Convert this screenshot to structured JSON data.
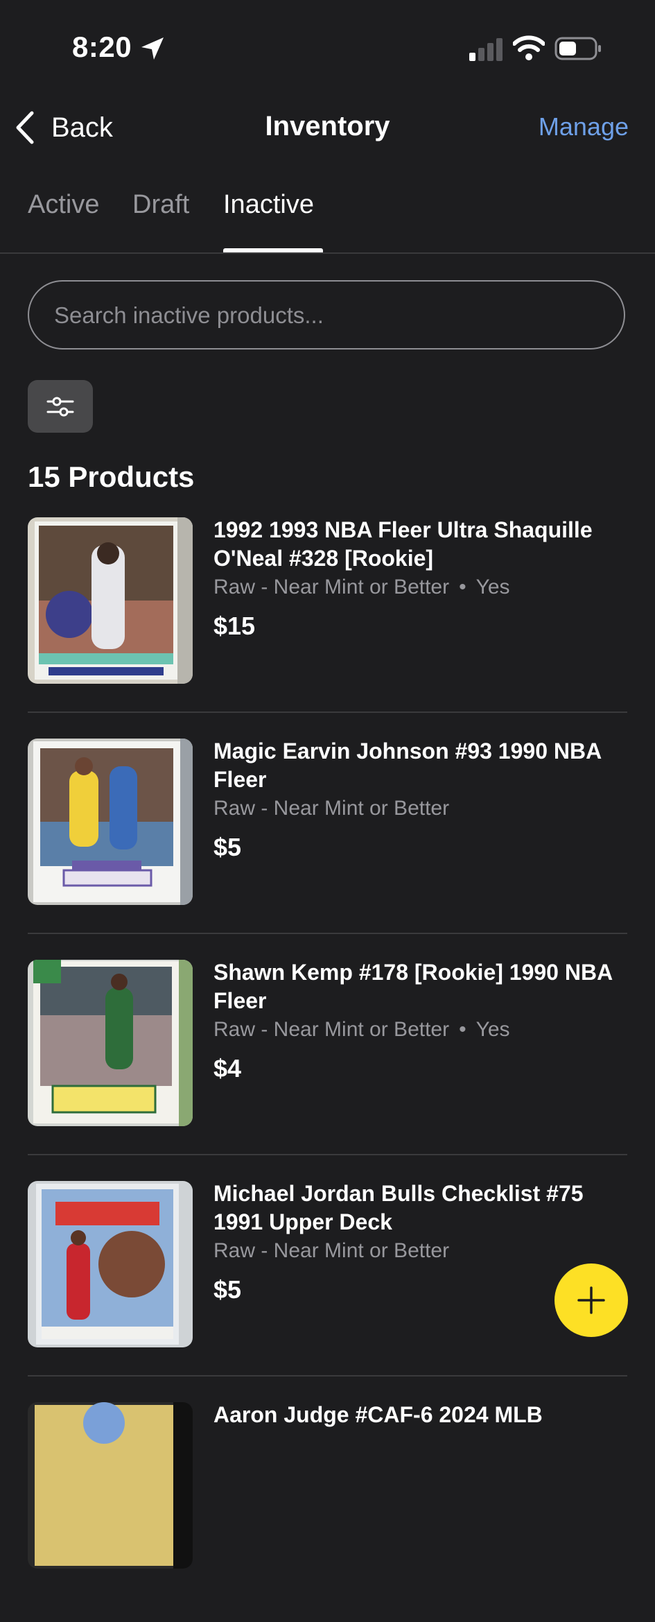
{
  "status": {
    "time": "8:20"
  },
  "nav": {
    "back_label": "Back",
    "title": "Inventory",
    "manage_label": "Manage"
  },
  "tabs": [
    {
      "label": "Active"
    },
    {
      "label": "Draft"
    },
    {
      "label": "Inactive",
      "selected": true
    }
  ],
  "search": {
    "placeholder": "Search inactive products..."
  },
  "filter": {
    "icon": "sliders-icon"
  },
  "products_count": "15 Products",
  "products": [
    {
      "title": "1992 1993 NBA Fleer Ultra Shaquille O'Neal #328 [Rookie]",
      "condition": "Raw - Near Mint or Better",
      "extra": "Yes",
      "price": "$15"
    },
    {
      "title": "Magic Earvin Johnson #93 1990 NBA Fleer",
      "condition": "Raw - Near Mint or Better",
      "extra": "",
      "price": "$5"
    },
    {
      "title": "Shawn Kemp #178 [Rookie] 1990 NBA Fleer",
      "condition": "Raw - Near Mint or Better",
      "extra": "Yes",
      "price": "$4"
    },
    {
      "title": "Michael Jordan Bulls Checklist #75 1991 Upper Deck",
      "condition": "Raw - Near Mint or Better",
      "extra": "",
      "price": "$5"
    },
    {
      "title": "Aaron Judge #CAF-6 2024 MLB",
      "condition": "",
      "extra": "",
      "price": ""
    }
  ],
  "fab": {
    "icon": "plus-icon"
  },
  "colors": {
    "background": "#1d1d1f",
    "accent_link": "#6ea0e8",
    "fab": "#fde025"
  }
}
